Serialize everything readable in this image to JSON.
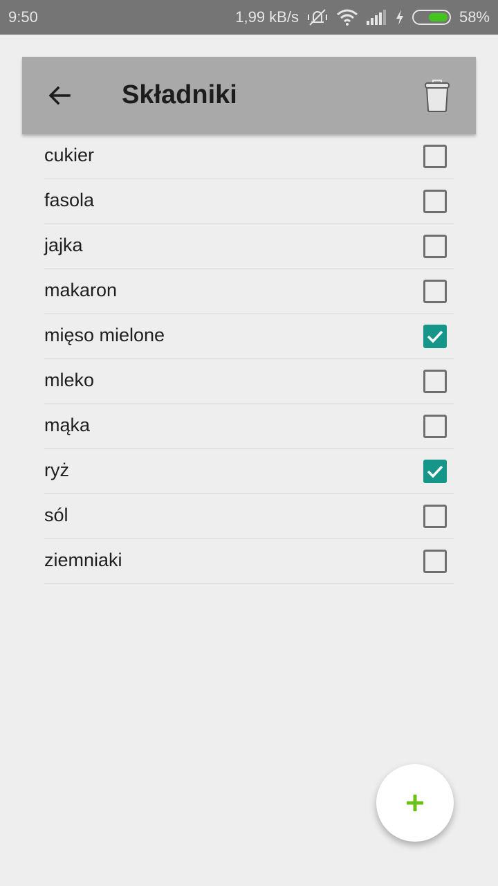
{
  "status_bar": {
    "time": "9:50",
    "speed": "1,99 kB/s",
    "battery_percent": "58%",
    "battery_level": 0.58,
    "icons": [
      "mute-vibrate-icon",
      "wifi-icon",
      "signal-icon",
      "charging-icon",
      "battery-icon"
    ]
  },
  "toolbar": {
    "title": "Składniki",
    "back_icon": "arrow-left-icon",
    "delete_icon": "trash-icon"
  },
  "ingredients": [
    {
      "name": "cukier",
      "checked": false
    },
    {
      "name": "fasola",
      "checked": false
    },
    {
      "name": "jajka",
      "checked": false
    },
    {
      "name": "makaron",
      "checked": false
    },
    {
      "name": "mięso mielone",
      "checked": true
    },
    {
      "name": "mleko",
      "checked": false
    },
    {
      "name": "mąka",
      "checked": false
    },
    {
      "name": "ryż",
      "checked": true
    },
    {
      "name": "sól",
      "checked": false
    },
    {
      "name": "ziemniaki",
      "checked": false
    }
  ],
  "fab": {
    "icon": "plus-icon",
    "color": "#6cc018"
  },
  "colors": {
    "toolbar": "#a9a9a9",
    "accent": "#169688",
    "status_bar": "#757575"
  }
}
